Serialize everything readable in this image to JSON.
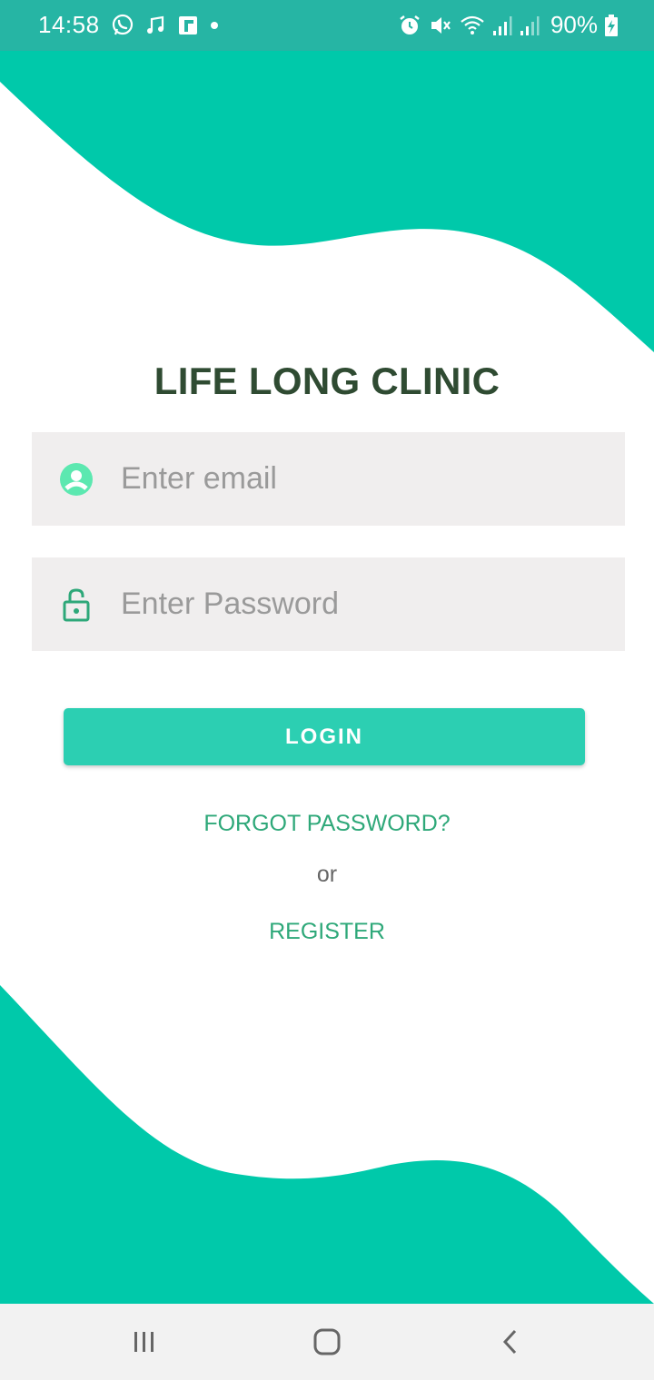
{
  "status_bar": {
    "time": "14:58",
    "battery_percent": "90%",
    "left_icons": [
      "whatsapp-icon",
      "music-note-icon",
      "flipboard-icon",
      "dot-icon"
    ],
    "right_icons": [
      "alarm-icon",
      "mute-icon",
      "wifi-icon",
      "signal-icon",
      "signal-icon",
      "battery-charging-icon"
    ],
    "background_color": "#26b5a4"
  },
  "app": {
    "title": "LIFE LONG CLINIC",
    "accent_color": "#00c9aa",
    "title_color": "#2f4b32"
  },
  "form": {
    "email": {
      "placeholder": "Enter email",
      "value": "",
      "icon": "account-circle-icon"
    },
    "password": {
      "placeholder": "Enter Password",
      "value": "",
      "icon": "lock-open-icon"
    },
    "login_label": "LOGIN",
    "forgot_label": "FORGOT PASSWORD?",
    "or_label": "or",
    "register_label": "REGISTER"
  },
  "nav_bar": {
    "buttons": [
      "recents-icon",
      "home-icon",
      "back-icon"
    ]
  }
}
